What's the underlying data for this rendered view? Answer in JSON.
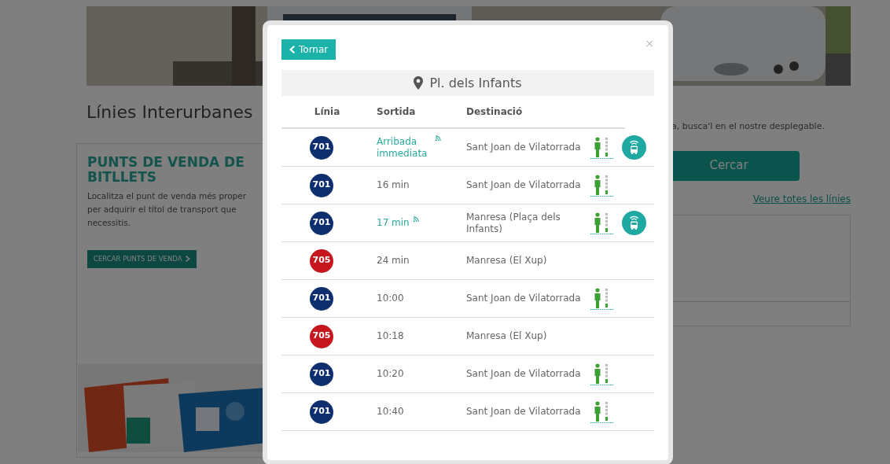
{
  "background_page": {
    "heading": "Línies Interurbanes",
    "sales_card": {
      "title": "PUNTS DE VENDA DE BITLLETS",
      "text": "Localitza el punt de venda més proper per adquirir el títol de transport que necessitis.",
      "button": "CERCAR PUNTS DE VENDA"
    },
    "search_hint": "a, busca'l en el nostre desplegable.",
    "search_button": "Cercar",
    "all_lines_link": "Veure totes les línies"
  },
  "modal": {
    "back_button": "Tornar",
    "close": "×",
    "stop_name": "Pl. dels Infants",
    "columns": [
      "Línia",
      "Sortida",
      "Destinació"
    ],
    "departures": [
      {
        "line": "701",
        "color": "#0d2f6e",
        "time": "Arribada immediata",
        "realtime": true,
        "destination": "Sant Joan de Vilatorrada",
        "accessible": true,
        "tracked": true
      },
      {
        "line": "701",
        "color": "#0d2f6e",
        "time": "16 min",
        "realtime": false,
        "destination": "Sant Joan de Vilatorrada",
        "accessible": true,
        "tracked": false
      },
      {
        "line": "701",
        "color": "#0d2f6e",
        "time": "17 min",
        "realtime": true,
        "destination": "Manresa (Plaça dels Infants)",
        "accessible": true,
        "tracked": true
      },
      {
        "line": "705",
        "color": "#c4161c",
        "time": "24 min",
        "realtime": false,
        "destination": "Manresa (El Xup)",
        "accessible": false,
        "tracked": false
      },
      {
        "line": "701",
        "color": "#0d2f6e",
        "time": "10:00",
        "realtime": false,
        "destination": "Sant Joan de Vilatorrada",
        "accessible": true,
        "tracked": false
      },
      {
        "line": "705",
        "color": "#c4161c",
        "time": "10:18",
        "realtime": false,
        "destination": "Manresa (El Xup)",
        "accessible": false,
        "tracked": false
      },
      {
        "line": "701",
        "color": "#0d2f6e",
        "time": "10:20",
        "realtime": false,
        "destination": "Sant Joan de Vilatorrada",
        "accessible": true,
        "tracked": false
      },
      {
        "line": "701",
        "color": "#0d2f6e",
        "time": "10:40",
        "realtime": false,
        "destination": "Sant Joan de Vilatorrada",
        "accessible": true,
        "tracked": false
      }
    ]
  }
}
